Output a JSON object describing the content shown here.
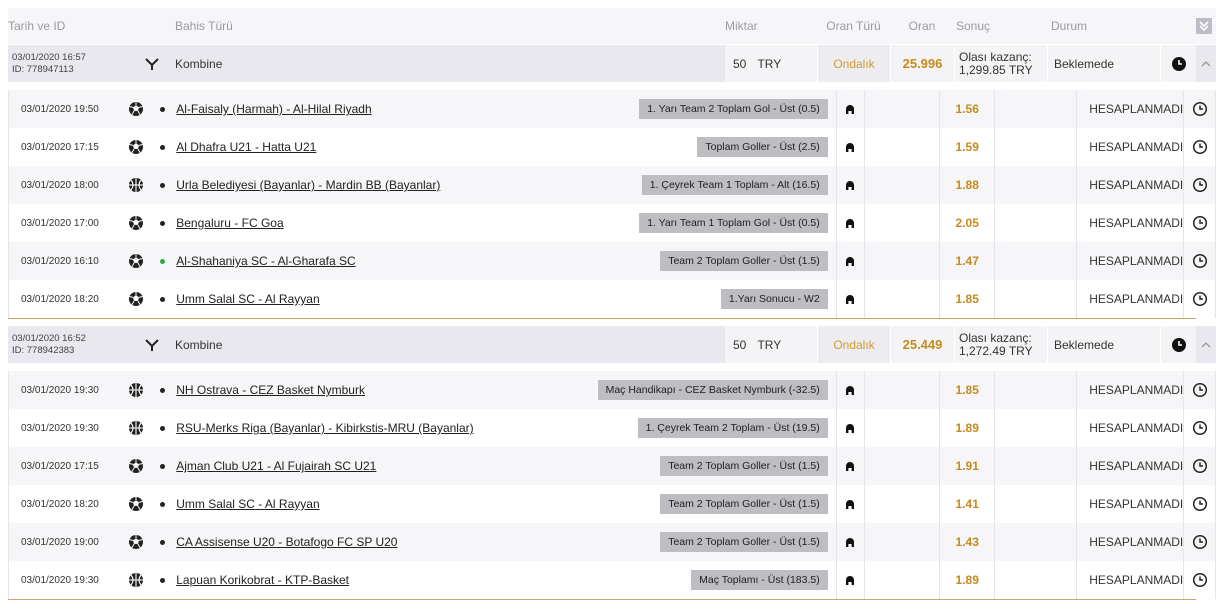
{
  "header": {
    "date_id": "Tarih ve ID",
    "bet_type": "Bahis Türü",
    "amount": "Miktar",
    "odds_type": "Oran Türü",
    "odds": "Oran",
    "result": "Sonuç",
    "status": "Durum",
    "toggle_icon": "double-chevron-down-icon"
  },
  "coupons": [
    {
      "date": "03/01/2020 16:57",
      "id": "ID: 778947113",
      "type": "Kombine",
      "amount": "50  TRY",
      "odds_type": "Ondalık",
      "odds": "25.996",
      "result_label": "Olası kazanç:",
      "result_value": "1,299.85 TRY",
      "status": "Beklemede",
      "events": [
        {
          "date": "03/01/2020 19:50",
          "sport": "football",
          "match": "Al-Faisaly (Harmah) - Al-Hilal Riyadh",
          "market": "1. Yarı Team 2 Toplam Gol - Üst (0.5)",
          "odds": "1.56",
          "status": "HESAPLANMADI",
          "live": false
        },
        {
          "date": "03/01/2020 17:15",
          "sport": "football",
          "match": "Al Dhafra U21 - Hatta U21",
          "market": "Toplam Goller - Üst (2.5)",
          "odds": "1.59",
          "status": "HESAPLANMADI",
          "live": false
        },
        {
          "date": "03/01/2020 18:00",
          "sport": "basketball",
          "match": "Urla Belediyesi (Bayanlar) - Mardin BB (Bayanlar)",
          "market": "1. Çeyrek Team 1 Toplam - Alt (16.5)",
          "odds": "1.88",
          "status": "HESAPLANMADI",
          "live": false
        },
        {
          "date": "03/01/2020 17:00",
          "sport": "football",
          "match": "Bengaluru - FC Goa",
          "market": "1. Yarı Team 1 Toplam Gol - Üst (0.5)",
          "odds": "2.05",
          "status": "HESAPLANMADI",
          "live": false
        },
        {
          "date": "03/01/2020 16:10",
          "sport": "football",
          "match": "Al-Shahaniya SC - Al-Gharafa SC",
          "market": "Team 2 Toplam Goller - Üst (1.5)",
          "odds": "1.47",
          "status": "HESAPLANMADI",
          "live": true
        },
        {
          "date": "03/01/2020 18:20",
          "sport": "football",
          "match": "Umm Salal SC - Al Rayyan",
          "market": "1.Yarı Sonucu - W2",
          "odds": "1.85",
          "status": "HESAPLANMADI",
          "live": false
        }
      ]
    },
    {
      "date": "03/01/2020 16:52",
      "id": "ID: 778942383",
      "type": "Kombine",
      "amount": "50  TRY",
      "odds_type": "Ondalık",
      "odds": "25.449",
      "result_label": "Olası kazanç:",
      "result_value": "1,272.49 TRY",
      "status": "Beklemede",
      "events": [
        {
          "date": "03/01/2020 19:30",
          "sport": "basketball",
          "match": "NH Ostrava - CEZ Basket Nymburk",
          "market": "Maç Handikapı - CEZ Basket Nymburk (-32.5)",
          "odds": "1.85",
          "status": "HESAPLANMADI",
          "live": false
        },
        {
          "date": "03/01/2020 19:30",
          "sport": "basketball",
          "match": "RSU-Merks Riga (Bayanlar) - Kibirkstis-MRU (Bayanlar)",
          "market": "1. Çeyrek Team 2 Toplam - Üst (19.5)",
          "odds": "1.89",
          "status": "HESAPLANMADI",
          "live": false
        },
        {
          "date": "03/01/2020 17:15",
          "sport": "football",
          "match": "Ajman Club U21 - Al Fujairah SC U21",
          "market": "Team 2 Toplam Goller - Üst (1.5)",
          "odds": "1.91",
          "status": "HESAPLANMADI",
          "live": false
        },
        {
          "date": "03/01/2020 18:20",
          "sport": "football",
          "match": "Umm Salal SC - Al Rayyan",
          "market": "Team 2 Toplam Goller - Üst (1.5)",
          "odds": "1.41",
          "status": "HESAPLANMADI",
          "live": false
        },
        {
          "date": "03/01/2020 19:00",
          "sport": "football",
          "match": "CA Assisense U20 - Botafogo FC SP U20",
          "market": "Team 2 Toplam Goller - Üst (1.5)",
          "odds": "1.43",
          "status": "HESAPLANMADI",
          "live": false
        },
        {
          "date": "03/01/2020 19:30",
          "sport": "basketball",
          "match": "Lapuan Korikobrat - KTP-Basket",
          "market": "Maç Toplamı - Üst (183.5)",
          "odds": "1.89",
          "status": "HESAPLANMADI",
          "live": false
        }
      ]
    }
  ]
}
